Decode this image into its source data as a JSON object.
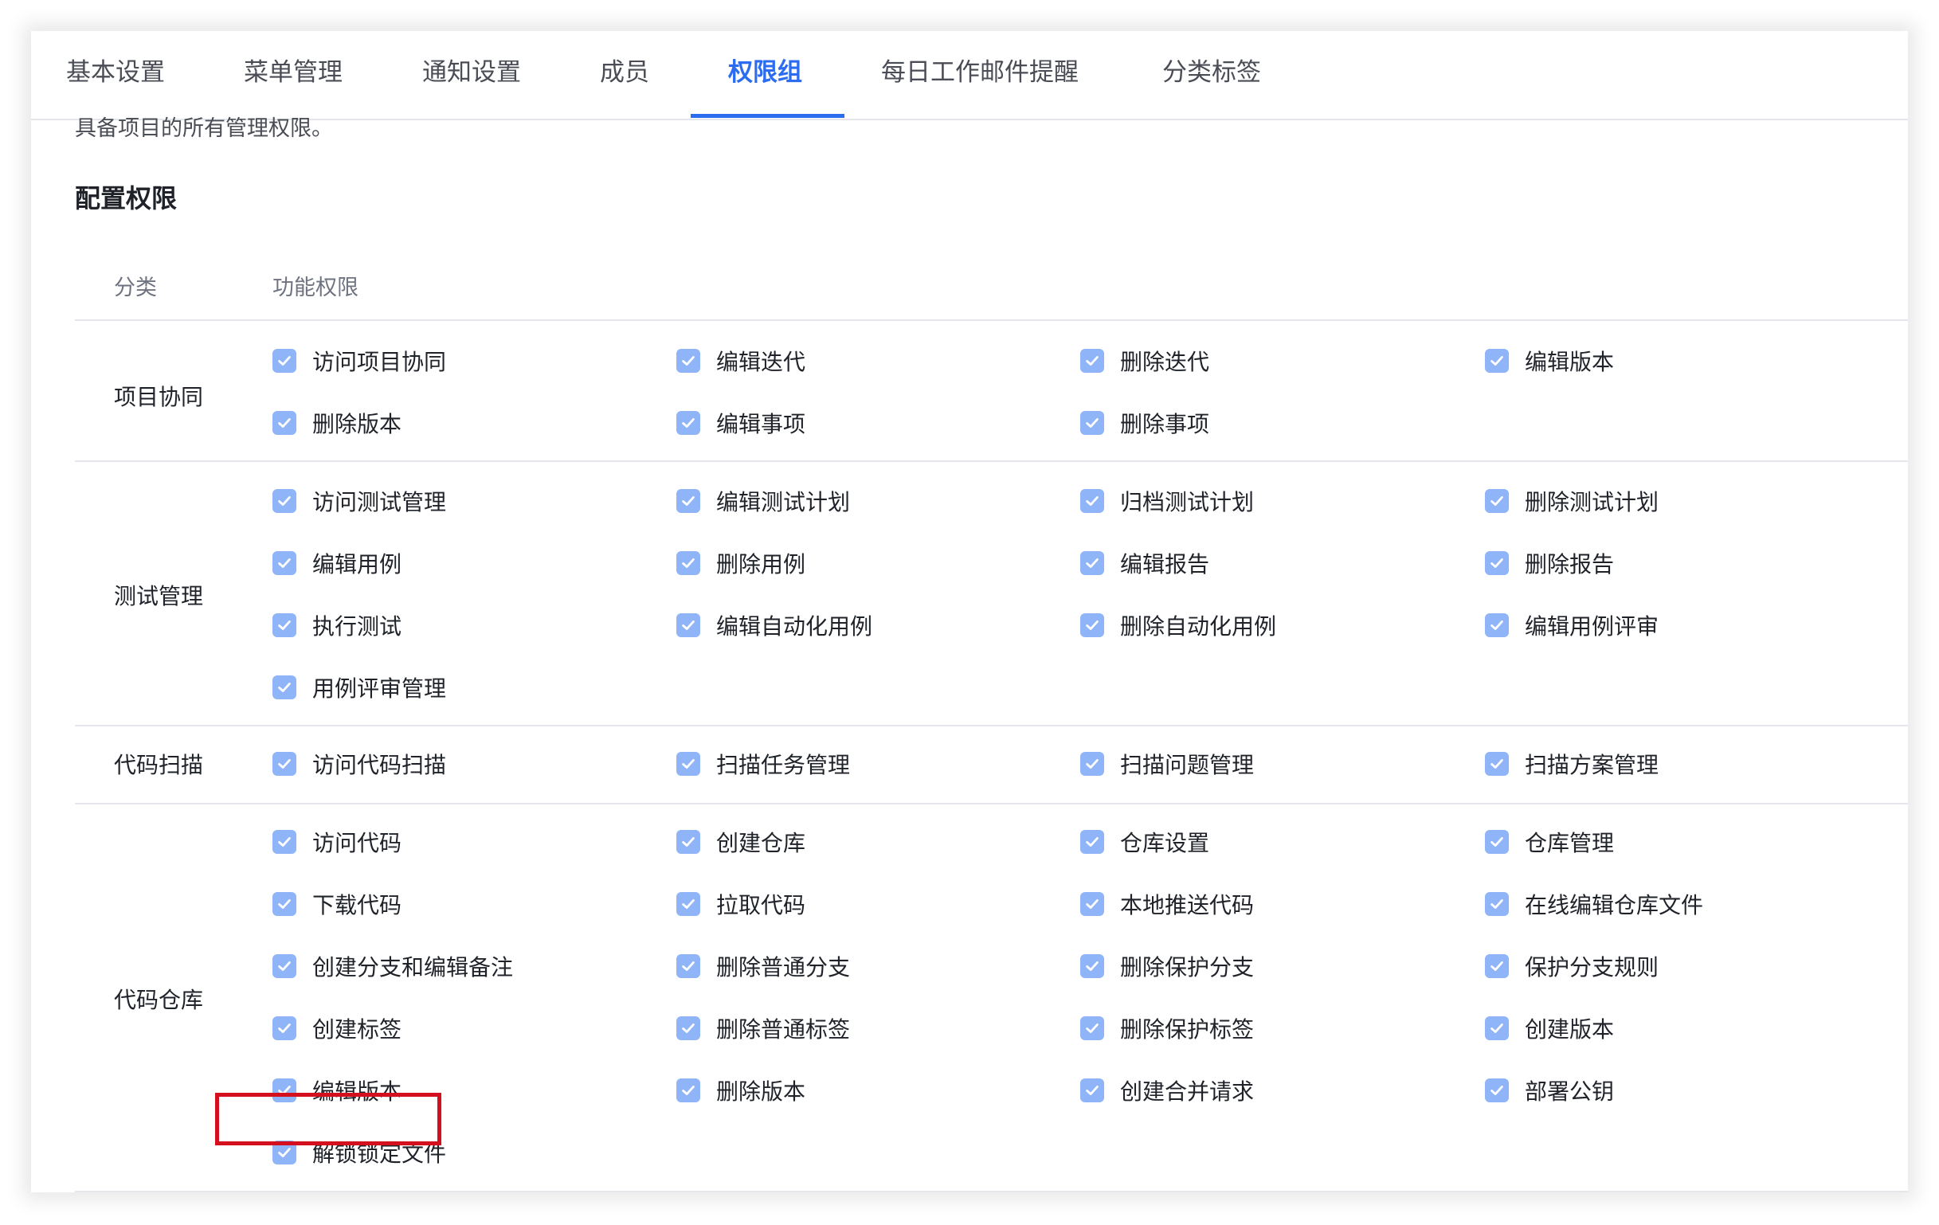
{
  "tabs": [
    {
      "label": "基本设置",
      "active": false
    },
    {
      "label": "菜单管理",
      "active": false
    },
    {
      "label": "通知设置",
      "active": false
    },
    {
      "label": "成员",
      "active": false
    },
    {
      "label": "权限组",
      "active": true
    },
    {
      "label": "每日工作邮件提醒",
      "active": false
    },
    {
      "label": "分类标签",
      "active": false
    }
  ],
  "description": "具备项目的所有管理权限。",
  "section_title": "配置权限",
  "table": {
    "headers": {
      "category": "分类",
      "permissions": "功能权限"
    },
    "groups": [
      {
        "category": "项目协同",
        "permissions": [
          "访问项目协同",
          "编辑迭代",
          "删除迭代",
          "编辑版本",
          "删除版本",
          "编辑事项",
          "删除事项"
        ]
      },
      {
        "category": "测试管理",
        "permissions": [
          "访问测试管理",
          "编辑测试计划",
          "归档测试计划",
          "删除测试计划",
          "编辑用例",
          "删除用例",
          "编辑报告",
          "删除报告",
          "执行测试",
          "编辑自动化用例",
          "删除自动化用例",
          "编辑用例评审",
          "用例评审管理"
        ]
      },
      {
        "category": "代码扫描",
        "permissions": [
          "访问代码扫描",
          "扫描任务管理",
          "扫描问题管理",
          "扫描方案管理"
        ]
      },
      {
        "category": "代码仓库",
        "permissions": [
          "访问代码",
          "创建仓库",
          "仓库设置",
          "仓库管理",
          "下载代码",
          "拉取代码",
          "本地推送代码",
          "在线编辑仓库文件",
          "创建分支和编辑备注",
          "删除普通分支",
          "删除保护分支",
          "保护分支规则",
          "创建标签",
          "删除普通标签",
          "删除保护标签",
          "创建版本",
          "编辑版本",
          "删除版本",
          "创建合并请求",
          "部署公钥",
          "解锁锁定文件"
        ]
      }
    ]
  },
  "checkbox_state": "checked",
  "colors": {
    "accent": "#2b6cf0",
    "checkbox_fill": "#8fb4f7",
    "highlight_border": "#d4101e"
  },
  "icons": {
    "checkbox": "check-icon"
  }
}
